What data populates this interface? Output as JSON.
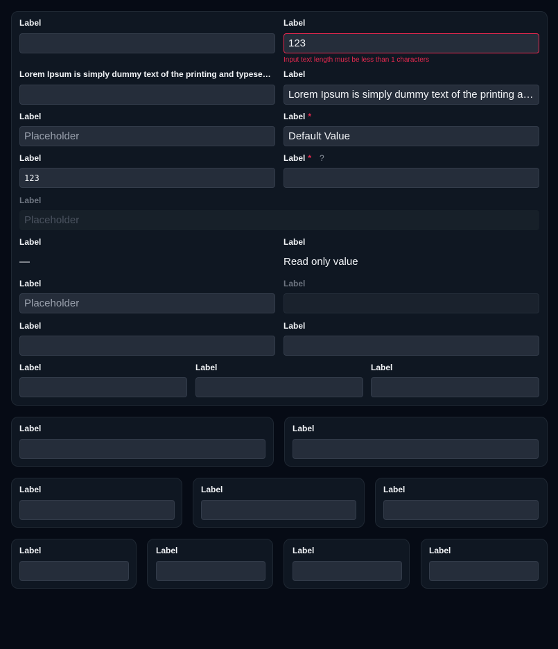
{
  "main": {
    "f1": {
      "label": "Label",
      "value": ""
    },
    "f2": {
      "label": "Label",
      "value": "123",
      "error": "Input text length must be less than 1 characters"
    },
    "f3": {
      "label": "Lorem Ipsum is simply dummy text of the printing and typesetting industry.",
      "value": ""
    },
    "f4": {
      "label": "Label",
      "value": "Lorem Ipsum is simply dummy text of the printing and typesetting industry."
    },
    "f5": {
      "label": "Label",
      "placeholder": "Placeholder"
    },
    "f6": {
      "label": "Label",
      "required_mark": "*",
      "value": "Default Value"
    },
    "f7": {
      "label": "Label",
      "value": "123"
    },
    "f8": {
      "label": "Label",
      "required_mark": "*",
      "help": "?",
      "value": ""
    },
    "f9": {
      "label": "Label",
      "placeholder": "Placeholder"
    },
    "f10": {
      "label": "Label",
      "value": "—"
    },
    "f11": {
      "label": "Label",
      "value": "Read only value"
    },
    "f12": {
      "label": "Label",
      "placeholder": "Placeholder"
    },
    "f13": {
      "label": "Label",
      "value": ""
    },
    "f14": {
      "label": "Label",
      "value": ""
    },
    "f15": {
      "label": "Label",
      "value": ""
    },
    "f16": {
      "label": "Label",
      "value": ""
    },
    "f17": {
      "label": "Label",
      "value": ""
    },
    "f18": {
      "label": "Label",
      "value": ""
    }
  },
  "two_col": [
    {
      "label": "Label"
    },
    {
      "label": "Label"
    }
  ],
  "three_col": [
    {
      "label": "Label"
    },
    {
      "label": "Label"
    },
    {
      "label": "Label"
    }
  ],
  "four_col": [
    {
      "label": "Label"
    },
    {
      "label": "Label"
    },
    {
      "label": "Label"
    },
    {
      "label": "Label"
    }
  ]
}
